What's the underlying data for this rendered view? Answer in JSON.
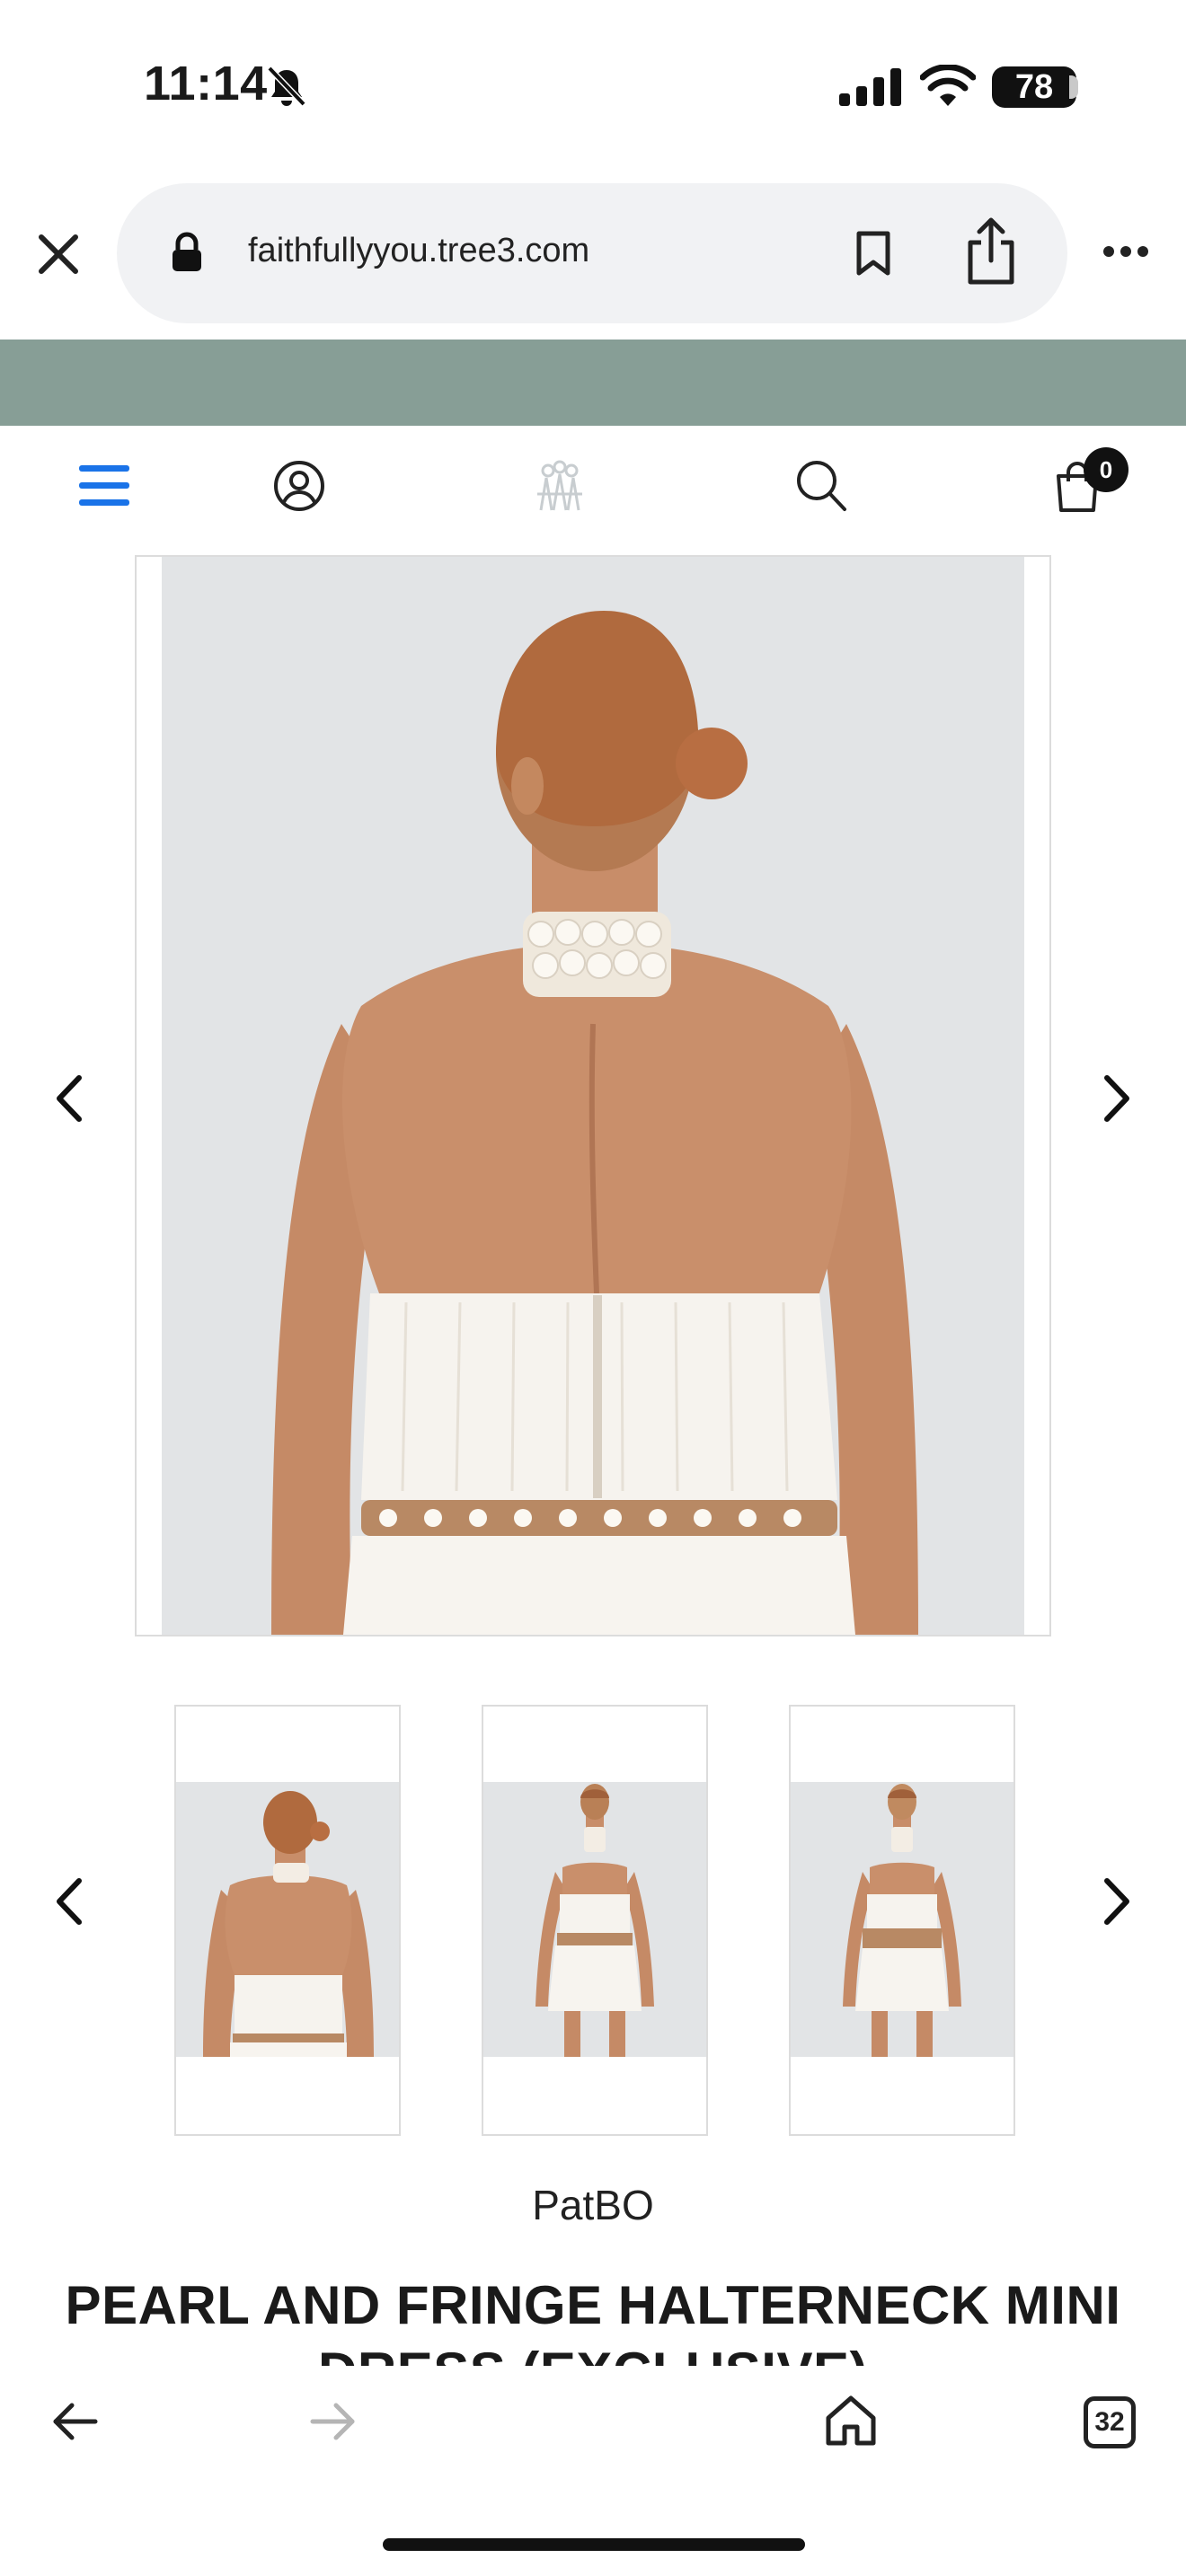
{
  "status_bar": {
    "time": "11:14",
    "battery": "78",
    "icons": [
      "silent-bell-icon",
      "signal-icon",
      "wifi-icon",
      "battery-icon"
    ]
  },
  "browser": {
    "url": "faithfullyyou.tree3.com",
    "icons": [
      "close-icon",
      "lock-icon",
      "bookmark-icon",
      "share-icon",
      "more-icon"
    ]
  },
  "header": {
    "cart_count": "0",
    "icons": [
      "hamburger-menu-icon",
      "account-icon",
      "store-logo",
      "search-icon",
      "cart-icon"
    ],
    "accent_color": "#1a73e8",
    "banner_color": "#879e96"
  },
  "product": {
    "brand": "PatBO",
    "title": "PEARL AND FRINGE HALTERNECK MINI DRESS (EXCLUSIVE)",
    "thumbnail_count": 3
  },
  "bottom_nav": {
    "tab_count": "32",
    "icons": [
      "back-arrow-icon",
      "forward-arrow-icon",
      "home-icon",
      "tabs-icon"
    ]
  }
}
